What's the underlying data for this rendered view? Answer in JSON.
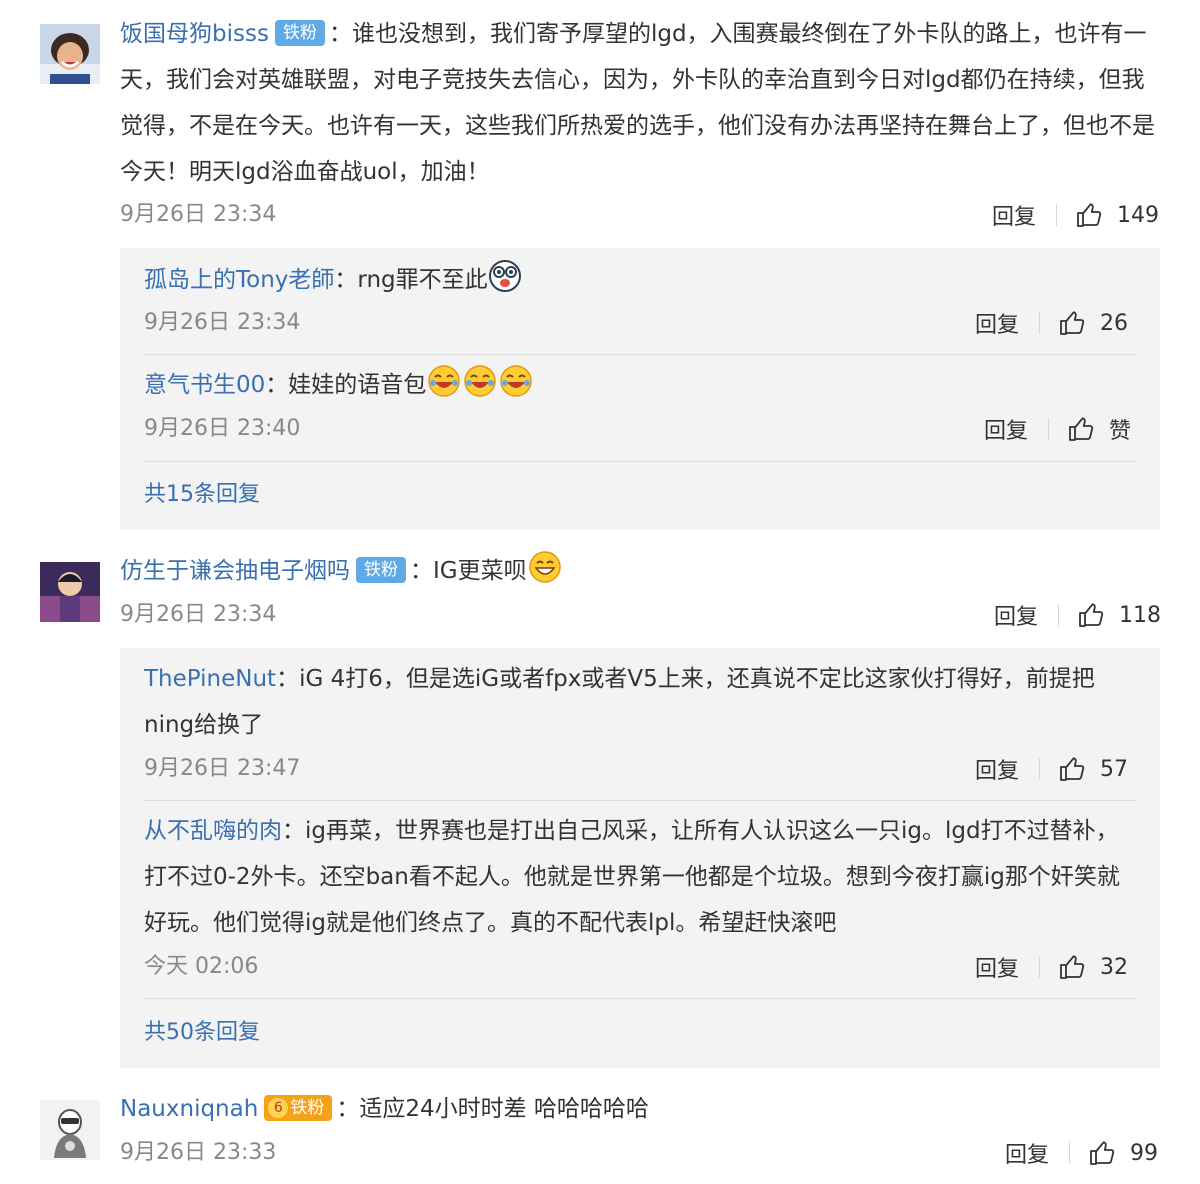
{
  "comments": [
    {
      "user": "饭国母狗bisss",
      "badge": "铁粉",
      "text": "谁也没想到，我们寄予厚望的lgd，入围赛最终倒在了外卡队的路上，也许有一天，我们会对英雄联盟，对电子竞技失去信心，因为，外卡队的幸治直到今日对lgd都仍在持续，但我觉得，不是在今天。也许有一天，这些我们所热爱的选手，他们没有办法再坚持在舞台上了，但也不是今天！明天lgd浴血奋战uol，加油！",
      "time": "9月26日 23:34",
      "reply": "回复",
      "likes": "149",
      "replies": [
        {
          "user": "孤岛上的Tony老師",
          "text": "rng罪不至此",
          "time": "9月26日 23:34",
          "reply": "回复",
          "likes": "26"
        },
        {
          "user": "意气书生00",
          "text": "娃娃的语音包",
          "time": "9月26日 23:40",
          "reply": "回复",
          "likes": "赞"
        }
      ],
      "more": "共15条回复"
    },
    {
      "user": "仿生于谦会抽电子烟吗",
      "badge": "铁粉",
      "text": "IG更菜呗",
      "time": "9月26日 23:34",
      "reply": "回复",
      "likes": "118",
      "replies": [
        {
          "user": "ThePineNut",
          "text": "iG 4打6，但是选iG或者fpx或者V5上来，还真说不定比这家伙打得好，前提把ning给换了",
          "time": "9月26日 23:47",
          "reply": "回复",
          "likes": "57"
        },
        {
          "user": "从不乱嗨的肉",
          "text": "ig再菜，世界赛也是打出自己风采，让所有人认识这么一只ig。lgd打不过替补，打不过0-2外卡。还空ban看不起人。他就是世界第一他都是个垃圾。想到今夜打赢ig那个奸笑就好玩。他们觉得ig就是他们终点了。真的不配代表lpl。希望赶快滚吧",
          "time": "今天 02:06",
          "reply": "回复",
          "likes": "32"
        }
      ],
      "more": "共50条回复"
    },
    {
      "user": "Nauxniqnah",
      "badge": "铁粉",
      "badge_rank": "6",
      "text": "适应24小时时差 哈哈哈哈哈",
      "time": "9月26日 23:33",
      "reply": "回复",
      "likes": "99"
    }
  ],
  "colors": {
    "link": "#3a6fb0",
    "badge": "#5fa9e6",
    "badge_gold": "#f4a21a",
    "panel": "#f3f3f3"
  },
  "icons": [
    "thumbs-up-icon",
    "laughing-emoji",
    "grinning-emoji",
    "shocked-face-emoji"
  ]
}
